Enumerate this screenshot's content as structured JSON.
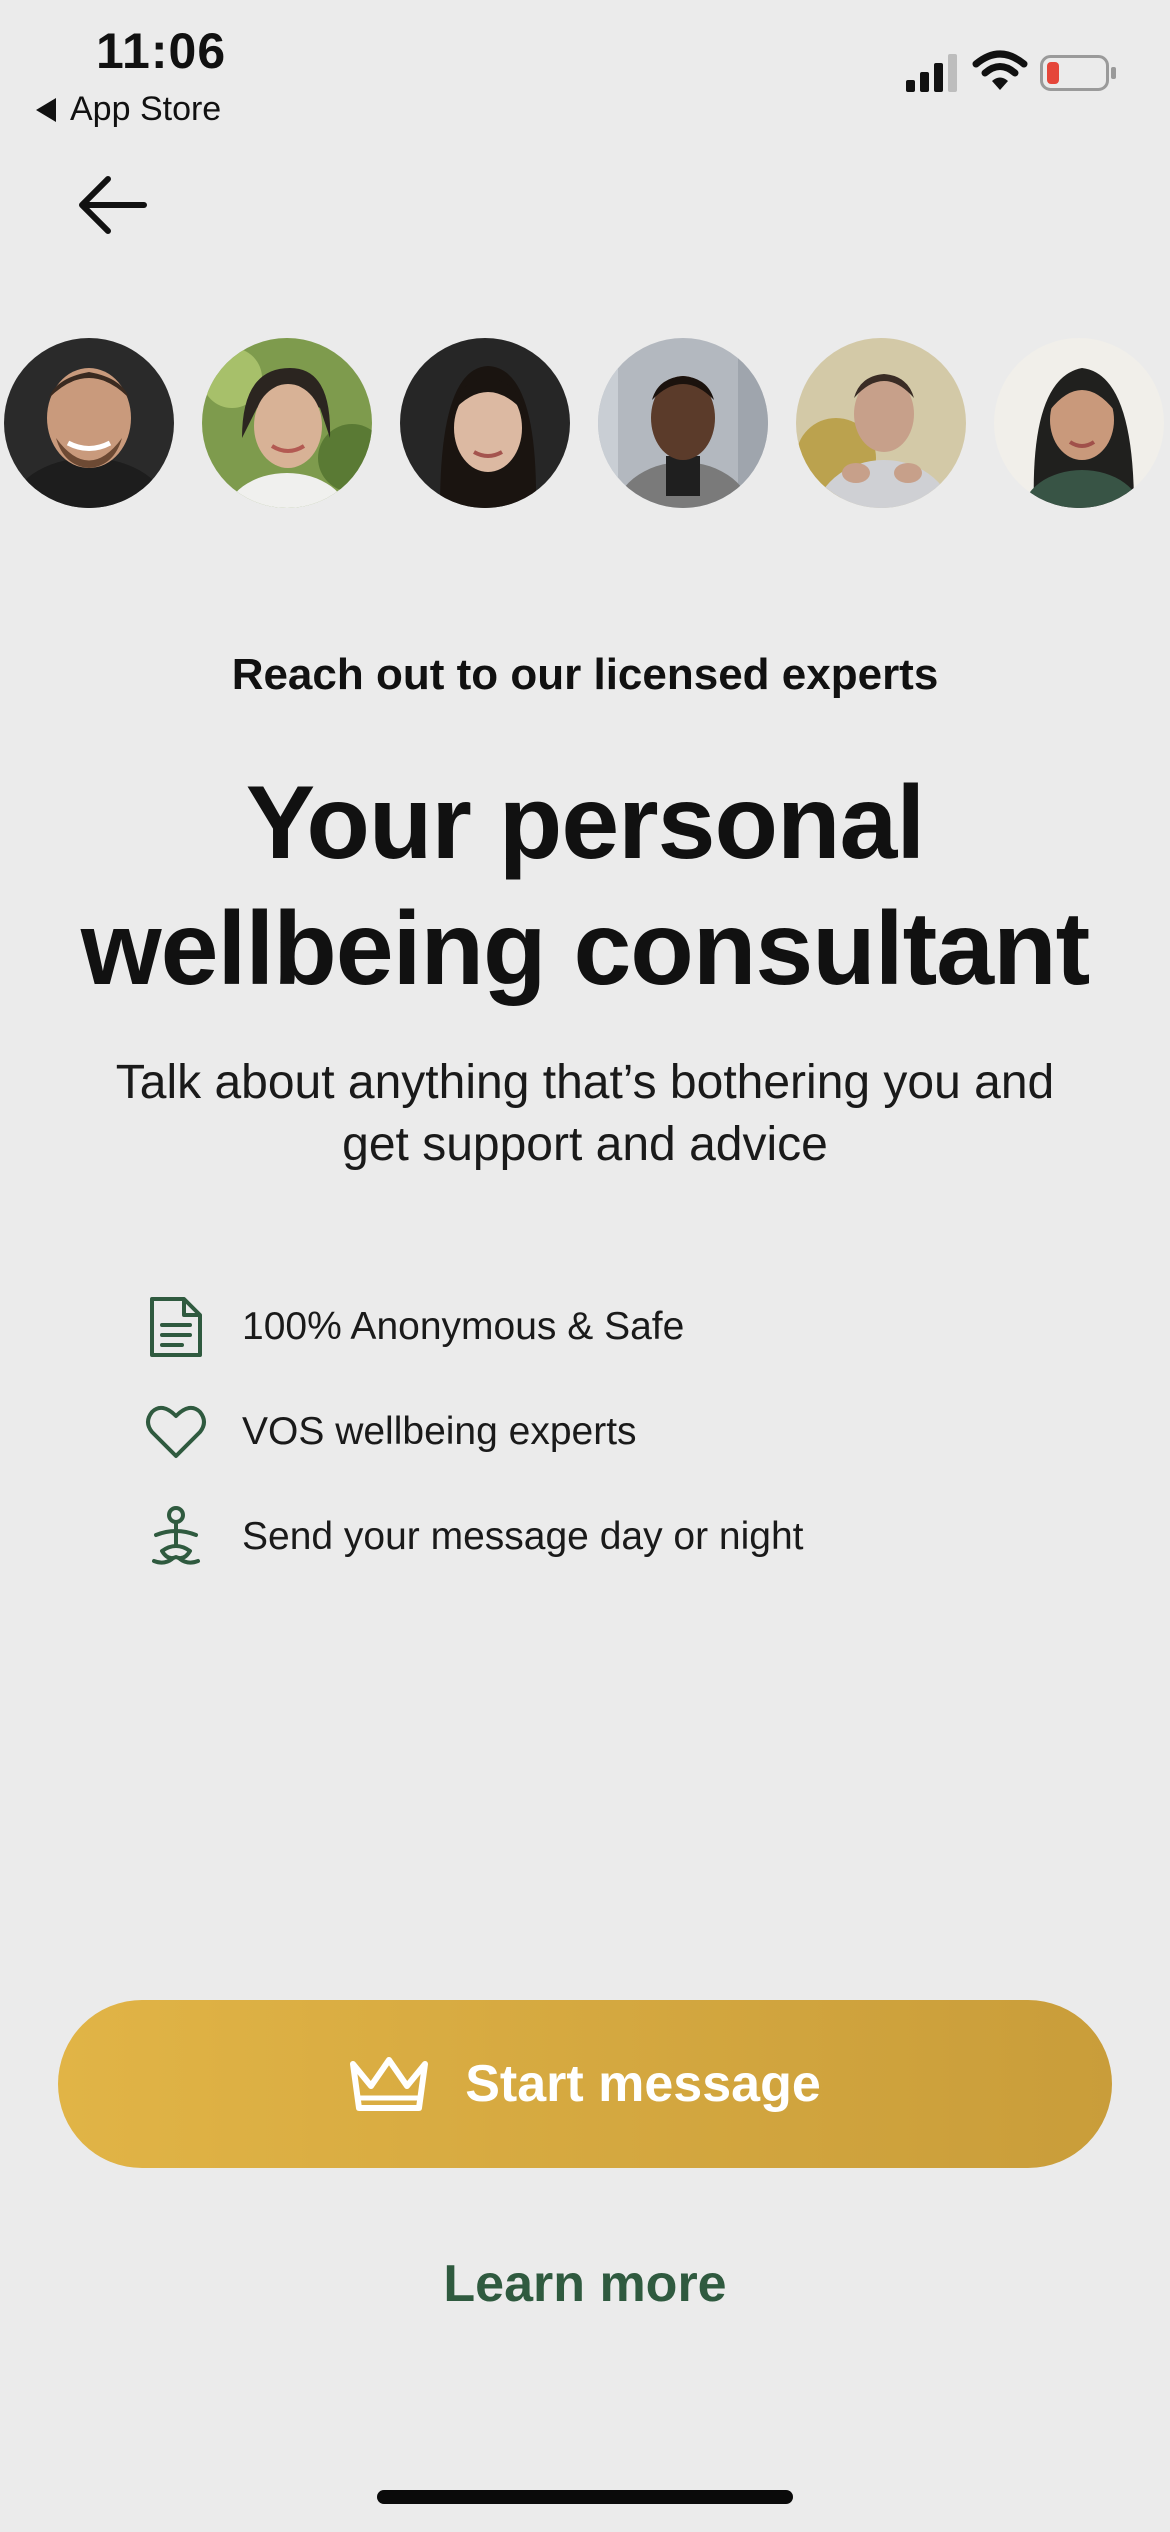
{
  "status_bar": {
    "time": "11:06",
    "back_label": "App Store"
  },
  "avatars": [
    {
      "name": "expert-1"
    },
    {
      "name": "expert-2"
    },
    {
      "name": "expert-3"
    },
    {
      "name": "expert-4"
    },
    {
      "name": "expert-5"
    },
    {
      "name": "expert-6"
    }
  ],
  "content": {
    "subtitle": "Reach out to our licensed experts",
    "headline_line1": "Your personal",
    "headline_line2": "wellbeing consultant",
    "description_line1": "Talk about anything that’s bothering you and",
    "description_line2": "get support and advice"
  },
  "features": [
    {
      "icon": "document-icon",
      "label": "100% Anonymous & Safe"
    },
    {
      "icon": "heart-icon",
      "label": "VOS wellbeing experts"
    },
    {
      "icon": "meditation-icon",
      "label": "Send your message day or night"
    }
  ],
  "actions": {
    "start_label": "Start message",
    "learn_more_label": "Learn more"
  },
  "colors": {
    "background": "#ebebeb",
    "accent_gold": "#d4a93f",
    "brand_green": "#2f5a3f",
    "battery_low": "#e5463a"
  }
}
